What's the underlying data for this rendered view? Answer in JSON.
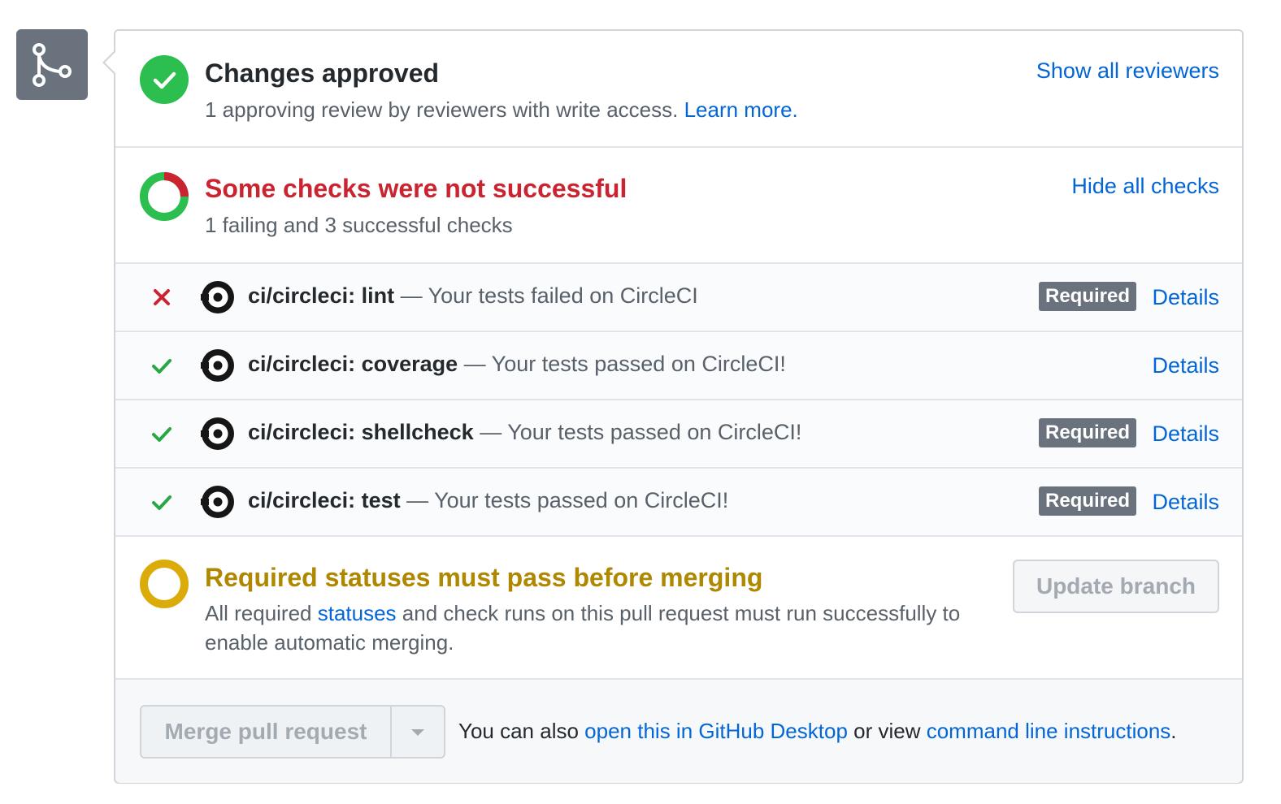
{
  "approved": {
    "title": "Changes approved",
    "sub_text": "1 approving review by reviewers with write access.",
    "learn_more": "Learn more.",
    "show_reviewers": "Show all reviewers"
  },
  "checks": {
    "title": "Some checks were not successful",
    "sub_text": "1 failing and 3 successful checks",
    "hide_checks": "Hide all checks",
    "items": [
      {
        "name": "ci/circleci: lint",
        "desc": " — Your tests failed on CircleCI",
        "status": "failed",
        "required": "Required",
        "details": "Details"
      },
      {
        "name": "ci/circleci: coverage",
        "desc": " — Your tests passed on CircleCI!",
        "status": "passed",
        "required": "",
        "details": "Details"
      },
      {
        "name": "ci/circleci: shellcheck",
        "desc": " — Your tests passed on CircleCI!",
        "status": "passed",
        "required": "Required",
        "details": "Details"
      },
      {
        "name": "ci/circleci: test",
        "desc": " — Your tests passed on CircleCI!",
        "status": "passed",
        "required": "Required",
        "details": "Details"
      }
    ]
  },
  "required_statuses": {
    "title": "Required statuses must pass before merging",
    "text_before": "All required ",
    "link": "statuses",
    "text_after": " and check runs on this pull request must run successfully to enable automatic merging.",
    "update_branch": "Update branch"
  },
  "merge": {
    "button": "Merge pull request",
    "note_prefix": "You can also ",
    "desktop_link": "open this in GitHub Desktop",
    "note_middle": " or view ",
    "cli_link": "command line instructions",
    "note_suffix": "."
  },
  "colors": {
    "success": "#2cbe4e",
    "failure": "#cb2431",
    "pending": "#dbab09",
    "link": "#0366d6",
    "badge": "#6a737d"
  },
  "icons": {
    "merge": "git-merge-icon",
    "approved": "check-circle-icon",
    "checks": "partial-ring-icon",
    "pending": "pending-ring-icon",
    "ci": "circleci-logo-icon"
  }
}
